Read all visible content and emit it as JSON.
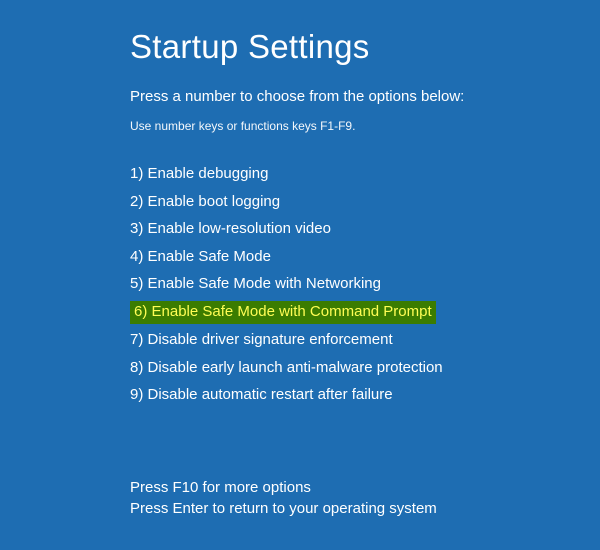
{
  "title": "Startup Settings",
  "subtitle": "Press a number to choose from the options below:",
  "hint": "Use number keys or functions keys F1-F9.",
  "options": [
    {
      "num": "1",
      "label": "Enable debugging",
      "highlighted": false
    },
    {
      "num": "2",
      "label": "Enable boot logging",
      "highlighted": false
    },
    {
      "num": "3",
      "label": "Enable low-resolution video",
      "highlighted": false
    },
    {
      "num": "4",
      "label": "Enable Safe Mode",
      "highlighted": false
    },
    {
      "num": "5",
      "label": "Enable Safe Mode with Networking",
      "highlighted": false
    },
    {
      "num": "6",
      "label": "Enable Safe Mode with Command Prompt",
      "highlighted": true
    },
    {
      "num": "7",
      "label": "Disable driver signature enforcement",
      "highlighted": false
    },
    {
      "num": "8",
      "label": "Disable early launch anti-malware protection",
      "highlighted": false
    },
    {
      "num": "9",
      "label": "Disable automatic restart after failure",
      "highlighted": false
    }
  ],
  "footer": {
    "more": "Press F10 for more options",
    "return": "Press Enter to return to your operating system"
  },
  "colors": {
    "background": "#1e6db2",
    "highlight_bg": "#3b7c00",
    "highlight_fg": "#fffd54"
  }
}
